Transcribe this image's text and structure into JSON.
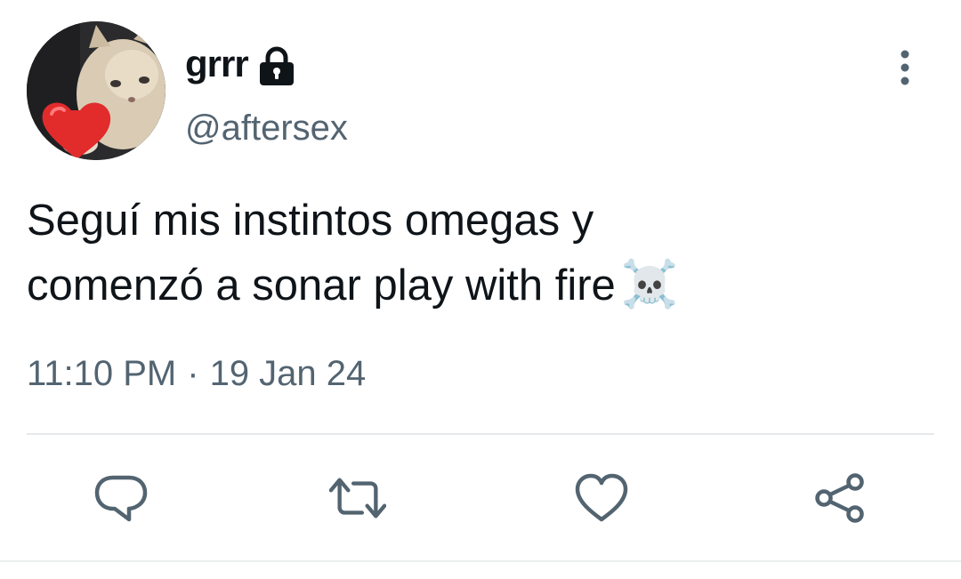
{
  "author": {
    "display_name": "grrr",
    "handle": "@aftersex",
    "protected": true,
    "avatar_icon": "cat-holding-heart-avatar"
  },
  "tweet": {
    "text_line1": "Seguí mis instintos omegas y",
    "text_line2": "comenzó a sonar play with fire",
    "emoji": "☠️"
  },
  "meta": {
    "time": "11:10 PM",
    "separator": "·",
    "date": "19 Jan 24"
  },
  "actions": [
    {
      "name": "reply",
      "icon": "reply-icon"
    },
    {
      "name": "retweet",
      "icon": "retweet-icon"
    },
    {
      "name": "like",
      "icon": "heart-icon"
    },
    {
      "name": "share",
      "icon": "share-icon"
    }
  ],
  "colors": {
    "text": "#0f1419",
    "secondary": "#536471",
    "divider": "#e6e9eb"
  }
}
